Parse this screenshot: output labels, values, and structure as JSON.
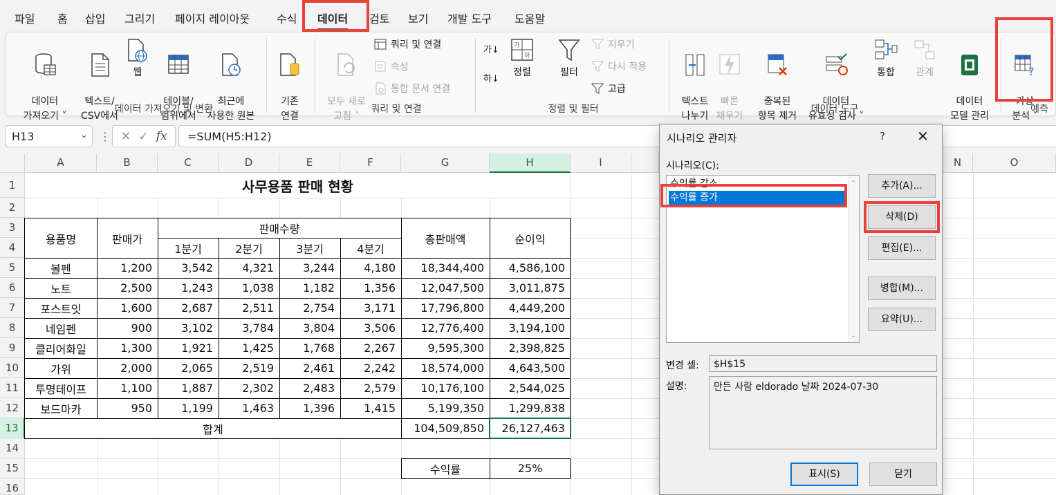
{
  "menu": {
    "tabs": [
      "파일",
      "홈",
      "삽입",
      "그리기",
      "페이지 레이아웃",
      "수식",
      "데이터",
      "검토",
      "보기",
      "개발 도구",
      "도움말"
    ],
    "active_tab": "데이터"
  },
  "ribbon": {
    "get_data": "데이터\n가져오기 ˅",
    "from_text": "텍스트/\nCSV에서",
    "web": "웹",
    "from_table": "테이블/\n범위에서",
    "recent_sources": "최근에\n사용한 원본",
    "existing": "기존\n연결",
    "group_get_transform": "데이터 가져오기 및 변환",
    "refresh_all": "모두 새로\n고침 ˅",
    "queries_connections": "쿼리 및 연결",
    "properties": "속성",
    "edit_links": "통합 문서 연결",
    "group_queries": "쿼리 및 연결",
    "sort": "정렬",
    "filter": "필터",
    "clear": "지우기",
    "reapply": "다시 적용",
    "advanced": "고급",
    "group_sort_filter": "정렬 및 필터",
    "text_to_columns": "텍스트\n나누기",
    "flash_fill": "빠른\n채우기",
    "remove_duplicates": "중복된\n항목 제거",
    "data_validation": "데이터\n유효성 검사 ˅",
    "consolidate": "통합",
    "relationships": "관계",
    "data_model": "데이터\n모델 관리",
    "group_data_tools": "데이터 도구",
    "what_if": "가상\n분석 ˅",
    "group_forecast": "예측",
    "sort_az": "가↓",
    "sort_za": "하↓",
    "icons": [
      "database-icon",
      "text-file-icon",
      "web-icon",
      "table-icon",
      "clock-icon",
      "cylinder-icon",
      "refresh-icon",
      "query-icon",
      "properties-icon",
      "link-icon",
      "sort-icon",
      "filter-icon",
      "eraser-icon",
      "reapply-icon",
      "advanced-filter-icon",
      "split-icon",
      "flash-icon",
      "dedupe-icon",
      "validation-icon",
      "consolidate-icon",
      "relations-icon",
      "datamodel-icon",
      "whatif-icon"
    ]
  },
  "formula_bar": {
    "name_box": "H13",
    "cancel": "✕",
    "enter": "✓",
    "fx": "fx",
    "formula": "=SUM(H5:H12)"
  },
  "sheet": {
    "columns": [
      "A",
      "B",
      "C",
      "D",
      "E",
      "F",
      "G",
      "H",
      "I",
      "N",
      "O"
    ],
    "rows": [
      "1",
      "2",
      "3",
      "4",
      "5",
      "6",
      "7",
      "8",
      "9",
      "10",
      "11",
      "12",
      "13",
      "14",
      "15",
      "16"
    ],
    "title": "사무용품 판매 현황",
    "headers": {
      "name": "용품명",
      "price": "판매가",
      "qty": "판매수량",
      "q1": "1분기",
      "q2": "2분기",
      "q3": "3분기",
      "q4": "4분기",
      "total": "총판매액",
      "profit": "순이익"
    },
    "data_rows": [
      [
        "볼펜",
        "1,200",
        "3,542",
        "4,321",
        "3,244",
        "4,180",
        "18,344,400",
        "4,586,100"
      ],
      [
        "노트",
        "2,500",
        "1,243",
        "1,038",
        "1,182",
        "1,356",
        "12,047,500",
        "3,011,875"
      ],
      [
        "포스트잇",
        "1,600",
        "2,687",
        "2,511",
        "2,754",
        "3,171",
        "17,796,800",
        "4,449,200"
      ],
      [
        "네임펜",
        "900",
        "3,102",
        "3,784",
        "3,804",
        "3,506",
        "12,776,400",
        "3,194,100"
      ],
      [
        "클리어화일",
        "1,300",
        "1,921",
        "1,425",
        "1,768",
        "2,267",
        "9,595,300",
        "2,398,825"
      ],
      [
        "가위",
        "2,000",
        "2,065",
        "2,519",
        "2,461",
        "2,242",
        "18,574,000",
        "4,643,500"
      ],
      [
        "투명테이프",
        "1,100",
        "1,887",
        "2,302",
        "2,483",
        "2,579",
        "10,176,100",
        "2,544,025"
      ],
      [
        "보드마카",
        "950",
        "1,199",
        "1,463",
        "1,396",
        "1,415",
        "5,199,350",
        "1,299,838"
      ]
    ],
    "sum_label": "합계",
    "sum_total": "104,509,850",
    "sum_profit": "26,127,463",
    "rate_label": "수익률",
    "rate_value": "25%"
  },
  "dialog": {
    "title": "시나리오 관리자",
    "help": "?",
    "close": "✕",
    "scenarios_label": "시나리오(C):",
    "scenarios": [
      "수익률 감소",
      "수익률 증가"
    ],
    "selected": "수익률 증가",
    "buttons": {
      "add": "추가(A)...",
      "delete": "삭제(D)",
      "edit": "편집(E)...",
      "merge": "병합(M)...",
      "summary": "요약(U)...",
      "show": "표시(S)",
      "close": "닫기"
    },
    "changing_cells_label": "변경 셀:",
    "changing_cells": "$H$15",
    "comment_label": "설명:",
    "comment": "만든 사람 eldorado 날짜 2024-07-30"
  },
  "colors": {
    "accent": "#1e7145",
    "highlight": "#e8403a",
    "selection": "#0078d7"
  }
}
